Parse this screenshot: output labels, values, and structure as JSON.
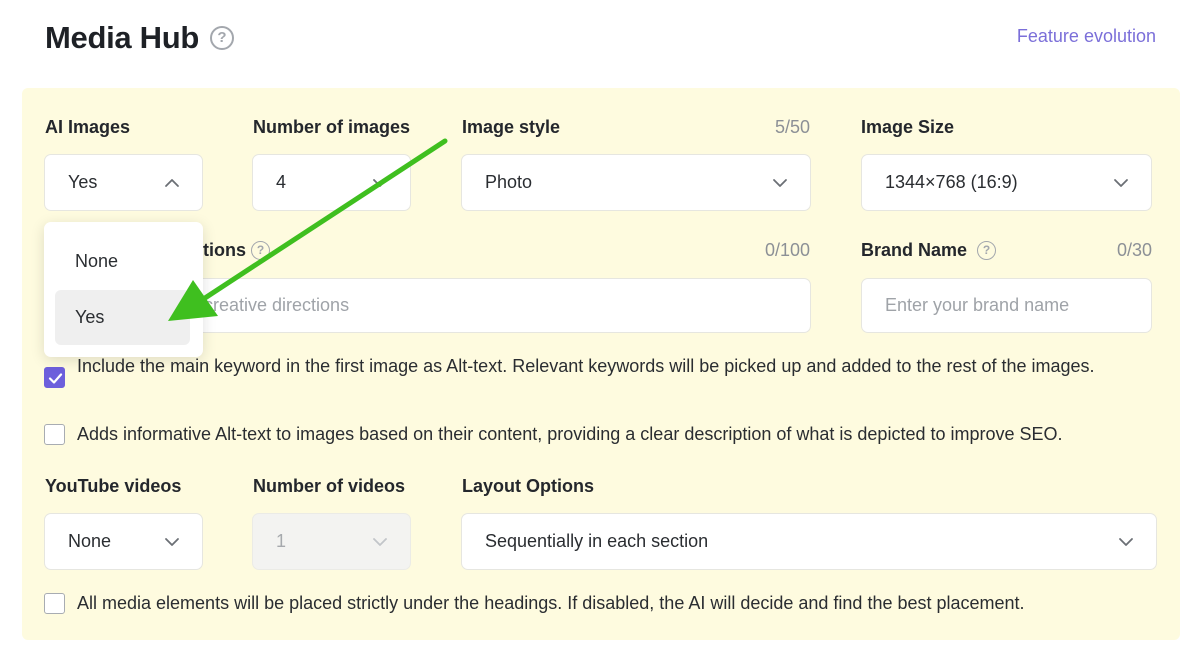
{
  "header": {
    "title": "Media Hub",
    "help_icon": "question-circle-icon",
    "feature_link": "Feature evolution"
  },
  "colors": {
    "panel_bg": "#fefbdf",
    "accent": "#6d5fdc",
    "link": "#7b6fd9",
    "arrow": "#3fbf1f"
  },
  "ai_images": {
    "label": "AI Images",
    "value": "Yes",
    "dropdown_open": true,
    "options": [
      "None",
      "Yes"
    ],
    "selected_option": "Yes"
  },
  "number_of_images": {
    "label": "Number of images",
    "value": "4"
  },
  "image_style": {
    "label": "Image style",
    "counter": "5/50",
    "value": "Photo"
  },
  "image_size": {
    "label": "Image Size",
    "value": "1344×768 (16:9)"
  },
  "creative_directions": {
    "label_visible": "tions",
    "counter": "0/100",
    "placeholder_visible": "creative directions"
  },
  "brand_name": {
    "label": "Brand Name",
    "counter": "0/30",
    "placeholder": "Enter your brand name"
  },
  "checkboxes": {
    "alt_keyword": {
      "checked": true,
      "text": "Include the main keyword in the first image as Alt-text. Relevant keywords will be picked up and added to the rest of the images."
    },
    "alt_informative": {
      "checked": false,
      "text": "Adds informative Alt-text to images based on their content, providing a clear description of what is depicted to improve SEO."
    },
    "placement": {
      "checked": false,
      "text": "All media elements will be placed strictly under the headings. If disabled, the AI will decide and find the best placement."
    }
  },
  "youtube_videos": {
    "label": "YouTube videos",
    "value": "None"
  },
  "number_of_videos": {
    "label": "Number of videos",
    "value": "1",
    "disabled": true
  },
  "layout_options": {
    "label": "Layout Options",
    "value": "Sequentially in each section"
  }
}
